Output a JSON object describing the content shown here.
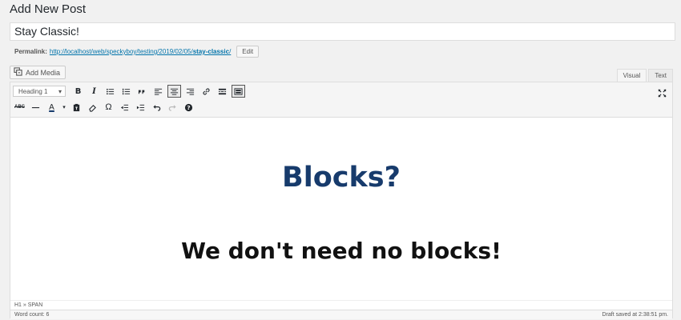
{
  "page": {
    "title": "Add New Post"
  },
  "post": {
    "title_value": "Stay Classic!"
  },
  "permalink": {
    "label": "Permalink:",
    "url_base": "http://localhost/web/speckyboy/testing/2019/02/05/",
    "slug": "stay-classic",
    "trailing": "/",
    "edit_label": "Edit"
  },
  "media": {
    "add_label": "Add Media"
  },
  "tabs": [
    {
      "label": "Visual",
      "active": true
    },
    {
      "label": "Text",
      "active": false
    }
  ],
  "toolbar": {
    "format_value": "Heading 1",
    "row1": [
      "bold",
      "italic",
      "bullet-list",
      "numbered-list",
      "blockquote",
      "align-left",
      "align-center",
      "align-right",
      "link",
      "read-more",
      "toolbar-toggle"
    ],
    "row2": [
      "strikethrough",
      "horizontal-line",
      "text-color",
      "paste-as-text",
      "clear-formatting",
      "special-character",
      "outdent",
      "indent",
      "undo",
      "redo",
      "help"
    ],
    "bold_glyph": "B",
    "italic_glyph": "I",
    "text_color_glyph": "A",
    "special_char_glyph": "Ω",
    "strike_glyph": "ABC"
  },
  "content": {
    "heading1": "Blocks?",
    "heading2": "We don't need no blocks!"
  },
  "status": {
    "path": "H1 » SPAN",
    "word_count": "Word count: 6",
    "draft_saved": "Draft saved at 2:38:51 pm."
  },
  "colors": {
    "heading1": "#173b6c",
    "link": "#0073aa"
  }
}
